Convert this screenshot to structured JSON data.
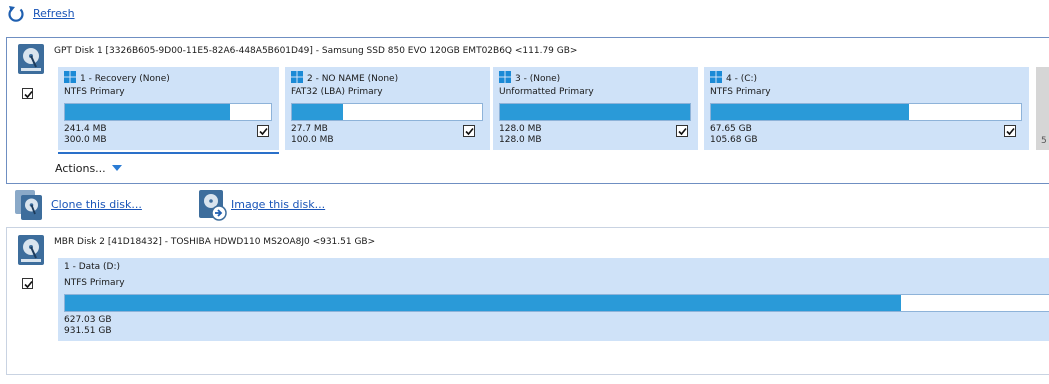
{
  "toolbar": {
    "refresh_label": "Refresh"
  },
  "disk1": {
    "title": "GPT Disk 1 [3326B605-9D00-11E5-82A6-448A5B601D49] - Samsung SSD 850 EVO 120GB EMT02B6Q  <111.79 GB>",
    "checked": true,
    "partitions": [
      {
        "label": "1 - Recovery (None)",
        "type": "NTFS Primary",
        "used": "241.4 MB",
        "total": "300.0 MB",
        "usage": 0.8,
        "checked": true,
        "selected": true
      },
      {
        "label": "2 - NO NAME (None)",
        "type": "FAT32 (LBA) Primary",
        "used": "27.7 MB",
        "total": "100.0 MB",
        "usage": 0.27,
        "checked": true
      },
      {
        "label": "3 -  (None)",
        "type": "Unformatted Primary",
        "used": "128.0 MB",
        "total": "128.0 MB",
        "usage": 1.0,
        "checked": true
      },
      {
        "label": "4 -  (C:)",
        "type": "NTFS Primary",
        "used": "67.65 GB",
        "total": "105.68 GB",
        "usage": 0.64,
        "checked": true
      }
    ],
    "overflow_label": "5",
    "actions_label": "Actions..."
  },
  "operations": {
    "clone_label": "Clone this disk...",
    "image_label": "Image this disk..."
  },
  "disk2": {
    "title": "MBR Disk 2 [41D18432] - TOSHIBA HDWD110 MS2OA8J0  <931.51 GB>",
    "checked": true,
    "partitions": [
      {
        "label": "1 - Data (D:)",
        "type": "NTFS Primary",
        "used": "627.03 GB",
        "total": "931.51 GB",
        "usage": 0.85
      }
    ]
  },
  "colors": {
    "accent": "#2a9ad8",
    "partition_bg": "#cfe2f8",
    "link": "#1a55b8"
  }
}
